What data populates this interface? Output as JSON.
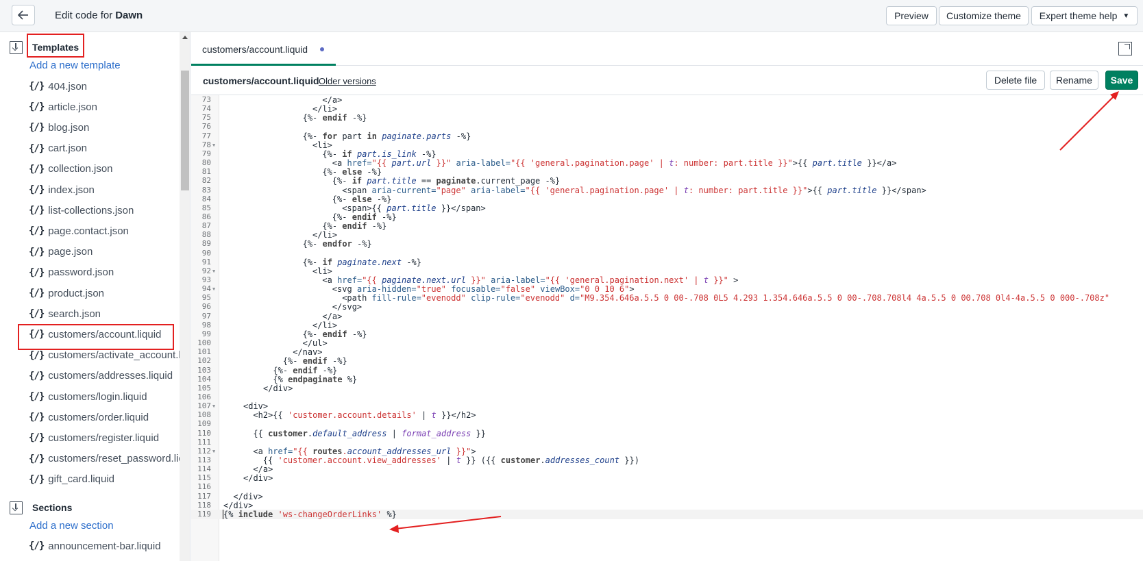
{
  "header": {
    "title_prefix": "Edit code for",
    "theme_name": "Dawn",
    "buttons": {
      "preview": "Preview",
      "customize": "Customize theme",
      "expert": "Expert theme help"
    }
  },
  "sidebar": {
    "templates_heading": "Templates",
    "add_template": "Add a new template",
    "templates": [
      "404.json",
      "article.json",
      "blog.json",
      "cart.json",
      "collection.json",
      "index.json",
      "list-collections.json",
      "page.contact.json",
      "page.json",
      "password.json",
      "product.json",
      "search.json",
      "customers/account.liquid",
      "customers/activate_account.liquid",
      "customers/addresses.liquid",
      "customers/login.liquid",
      "customers/order.liquid",
      "customers/register.liquid",
      "customers/reset_password.liquid",
      "gift_card.liquid"
    ],
    "sections_heading": "Sections",
    "add_section": "Add a new section",
    "sections": [
      "announcement-bar.liquid"
    ],
    "file_icon": "{/}"
  },
  "editor": {
    "tab_label": "customers/account.liquid",
    "file_name": "customers/account.liquid",
    "older_versions": "Older versions",
    "buttons": {
      "delete": "Delete file",
      "rename": "Rename",
      "save": "Save"
    },
    "first_line_number": 73,
    "folded_lines": [
      78,
      92,
      94,
      107,
      112
    ],
    "active_line": 119
  },
  "colors": {
    "accent": "#008060",
    "link": "#2c6ecb",
    "annotation": "#e32020",
    "unsaved_dot": "#5c6ac4"
  }
}
